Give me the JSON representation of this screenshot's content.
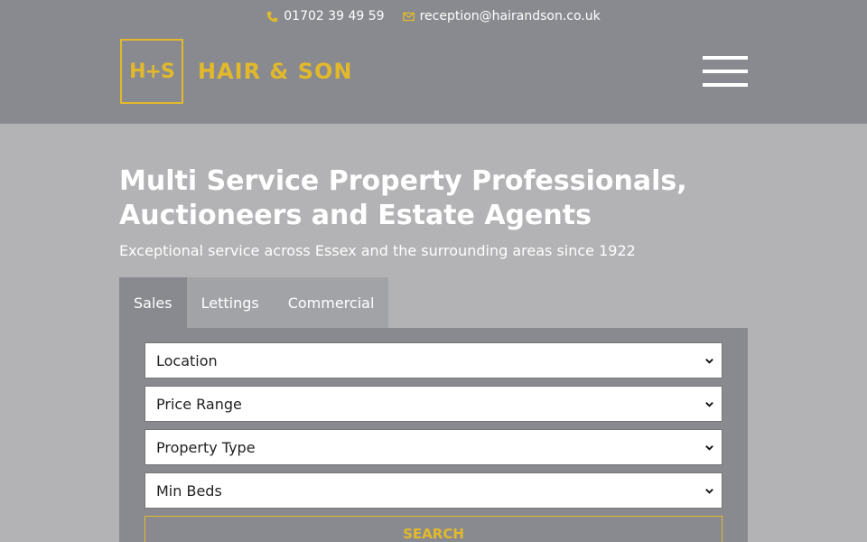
{
  "contact": {
    "phone": "01702 39 49 59",
    "email": "reception@hairandson.co.uk"
  },
  "logo": {
    "mark": "H+S",
    "text": "HAIR & SON"
  },
  "hero": {
    "title": "Multi Service Property Professionals, Auctioneers and Estate Agents",
    "subtitle": "Exceptional service across Essex and the surrounding areas since 1922"
  },
  "tabs": [
    {
      "label": "Sales",
      "active": true
    },
    {
      "label": "Lettings",
      "active": false
    },
    {
      "label": "Commercial",
      "active": false
    }
  ],
  "search": {
    "location": "Location",
    "price_range": "Price Range",
    "property_type": "Property Type",
    "min_beds": "Min Beds",
    "button": "SEARCH"
  },
  "colors": {
    "accent": "#e2b92a",
    "header_bg": "#898a90",
    "page_bg": "#b3b3b5"
  },
  "icons": {
    "phone": "phone-icon",
    "email": "envelope-icon",
    "menu": "hamburger-menu-icon",
    "dropdown": "chevron-down-icon"
  }
}
